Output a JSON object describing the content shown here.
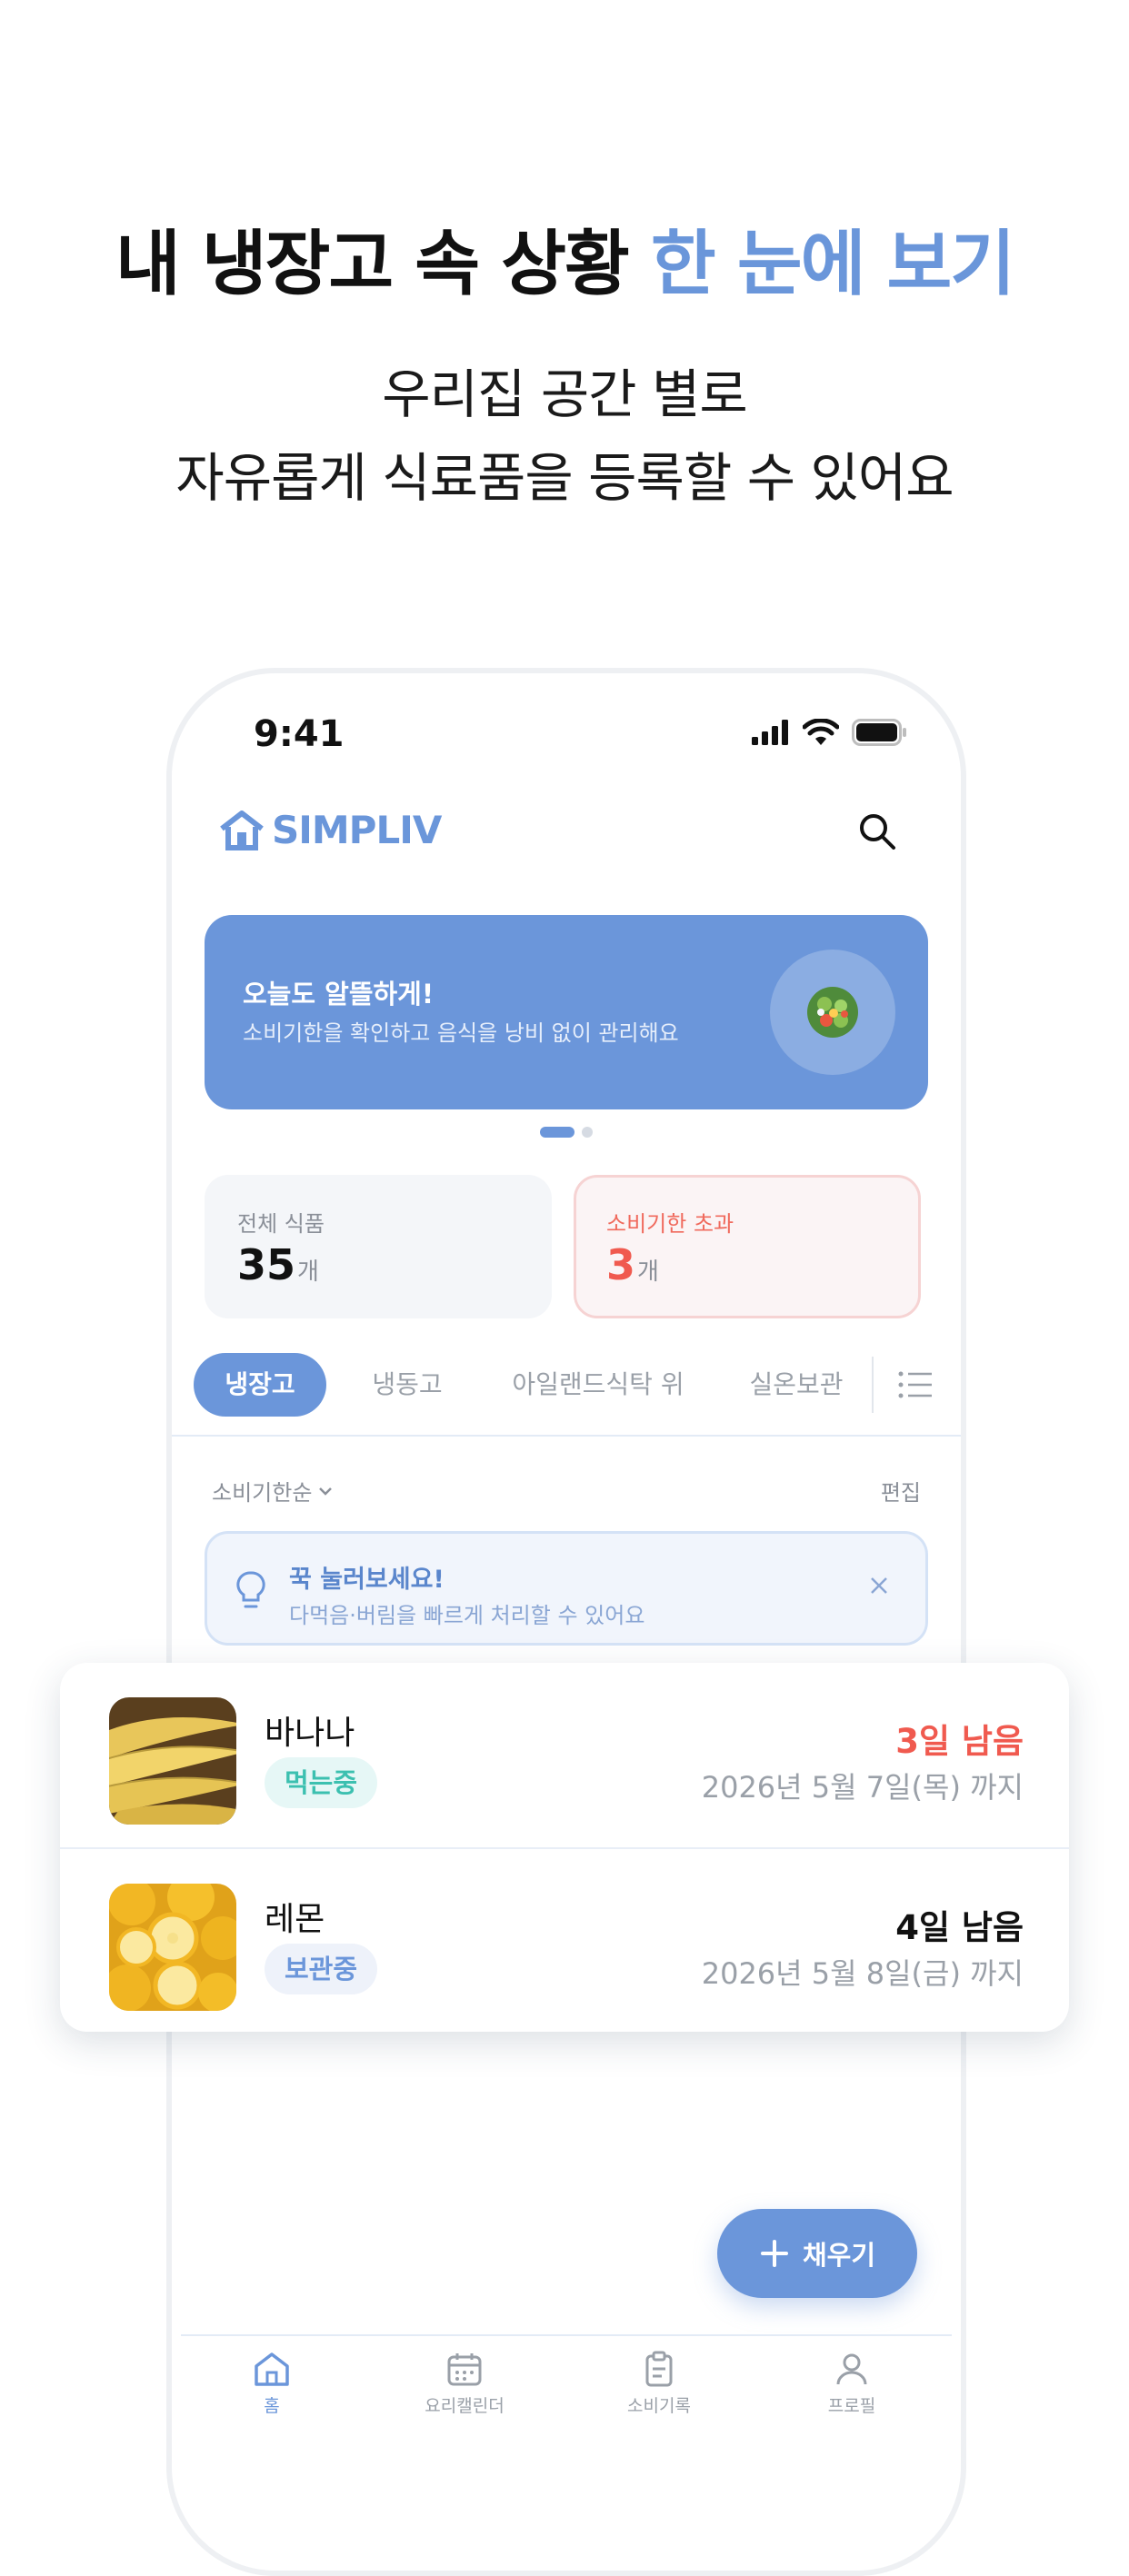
{
  "headline": {
    "part1": "내 냉장고 속 상황",
    "part2": "한 눈에 보기"
  },
  "subline": {
    "line1": "우리집 공간 별로",
    "line2": "자유롭게 식료품을 등록할 수 있어요"
  },
  "status_bar": {
    "time": "9:41"
  },
  "app": {
    "logo": "SIMPLIV"
  },
  "banner": {
    "title": "오늘도 알뜰하게!",
    "description": "소비기한을 확인하고 음식을 낭비 없이 관리해요"
  },
  "stats": {
    "total": {
      "label": "전체 식품",
      "value": "35",
      "unit": "개"
    },
    "expired": {
      "label": "소비기한 초과",
      "value": "3",
      "unit": "개"
    }
  },
  "tabs": [
    {
      "label": "냉장고",
      "active": true
    },
    {
      "label": "냉동고",
      "active": false
    },
    {
      "label": "아일랜드식탁 위",
      "active": false
    },
    {
      "label": "실온보관",
      "active": false
    }
  ],
  "list_header": {
    "sort": "소비기한순",
    "edit": "편집"
  },
  "tip": {
    "title": "꾹 눌러보세요!",
    "description": "다먹음·버림을 빠르게 처리할 수 있어요"
  },
  "items": [
    {
      "name": "바나나",
      "status": "먹는중",
      "remaining": "3일 남음",
      "date": "2026년 5월 7일(목) 까지"
    },
    {
      "name": "레몬",
      "status": "보관중",
      "remaining": "4일 남음",
      "date": "2026년 5월 8일(금) 까지"
    }
  ],
  "fab": {
    "label": "채우기"
  },
  "nav": [
    {
      "label": "홈",
      "icon": "home-icon"
    },
    {
      "label": "요리캘린더",
      "icon": "calendar-icon"
    },
    {
      "label": "소비기록",
      "icon": "clipboard-icon"
    },
    {
      "label": "프로필",
      "icon": "person-icon"
    }
  ],
  "colors": {
    "accent": "#6b96da",
    "danger": "#f05a4f",
    "mint": "#3cc0b0"
  }
}
